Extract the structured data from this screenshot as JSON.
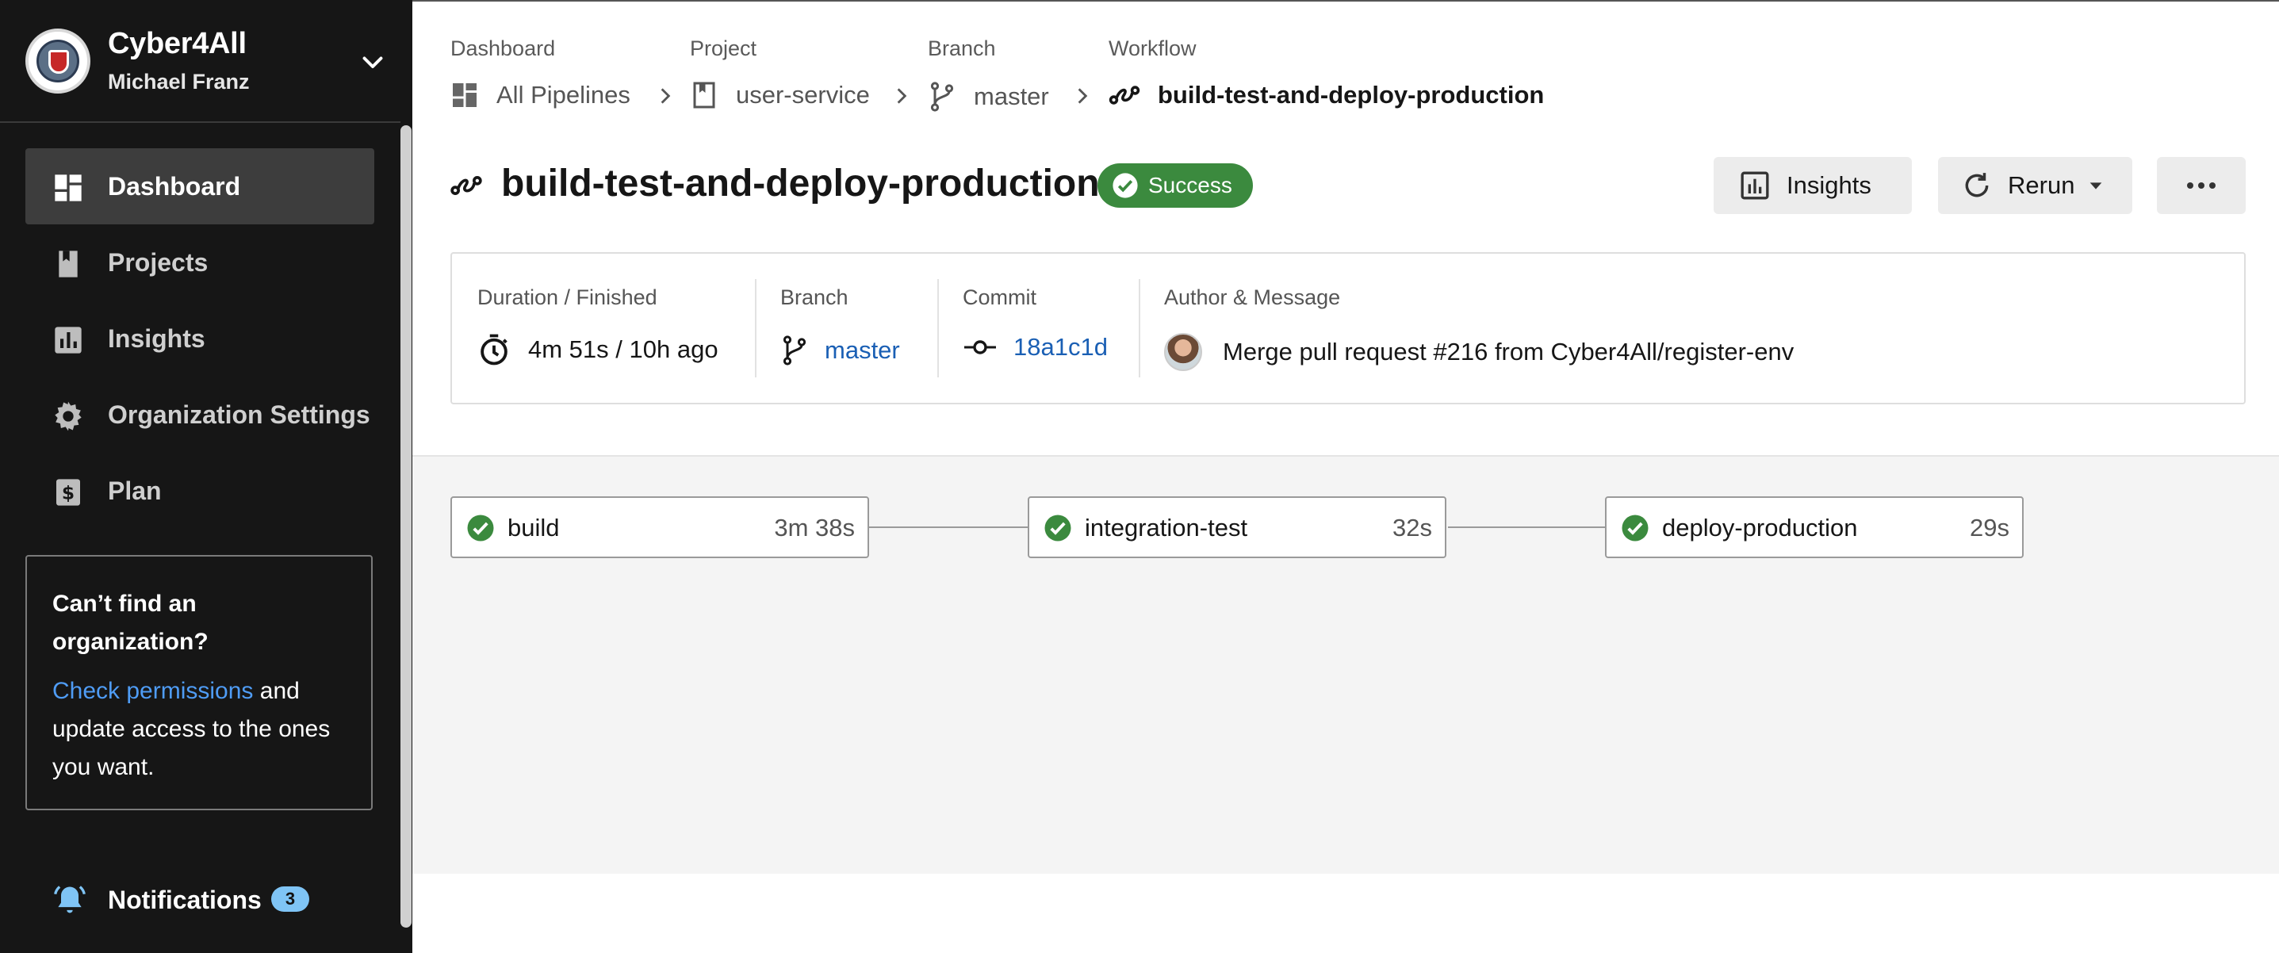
{
  "sidebar": {
    "org_name": "Cyber4All",
    "user_name": "Michael Franz",
    "nav": [
      {
        "label": "Dashboard",
        "icon": "dashboard-icon",
        "active": true
      },
      {
        "label": "Projects",
        "icon": "book-icon"
      },
      {
        "label": "Insights",
        "icon": "bar-chart-icon"
      },
      {
        "label": "Organization Settings",
        "icon": "gear-icon"
      },
      {
        "label": "Plan",
        "icon": "dollar-icon"
      }
    ],
    "help": {
      "title": "Can’t find an organization?",
      "link": "Check permissions",
      "body_rest": " and update access to the ones you want."
    },
    "notifications": {
      "label": "Notifications",
      "count": "3"
    }
  },
  "breadcrumbs": [
    {
      "caption": "Dashboard",
      "value": "All Pipelines",
      "icon": "dashboard-icon"
    },
    {
      "caption": "Project",
      "value": "user-service",
      "icon": "book-icon"
    },
    {
      "caption": "Branch",
      "value": "master",
      "icon": "branch-icon"
    },
    {
      "caption": "Workflow",
      "value": "build-test-and-deploy-production",
      "icon": "workflow-icon"
    }
  ],
  "workflow": {
    "title": "build-test-and-deploy-production",
    "status": "Success"
  },
  "actions": {
    "insights": "Insights",
    "rerun": "Rerun"
  },
  "meta": {
    "duration_caption": "Duration / Finished",
    "duration_value": "4m 51s / 10h ago",
    "branch_caption": "Branch",
    "branch_value": "master",
    "commit_caption": "Commit",
    "commit_value": "18a1c1d",
    "author_caption": "Author & Message",
    "message": "Merge pull request #216 from Cyber4All/register-env"
  },
  "jobs": [
    {
      "name": "build",
      "duration": "3m 38s",
      "status": "success"
    },
    {
      "name": "integration-test",
      "duration": "32s",
      "status": "success"
    },
    {
      "name": "deploy-production",
      "duration": "29s",
      "status": "success"
    }
  ],
  "colors": {
    "success": "#3b8a3e",
    "link": "#1a5fb4",
    "sidebar_bg": "#161616",
    "badge": "#7fc4f5"
  }
}
